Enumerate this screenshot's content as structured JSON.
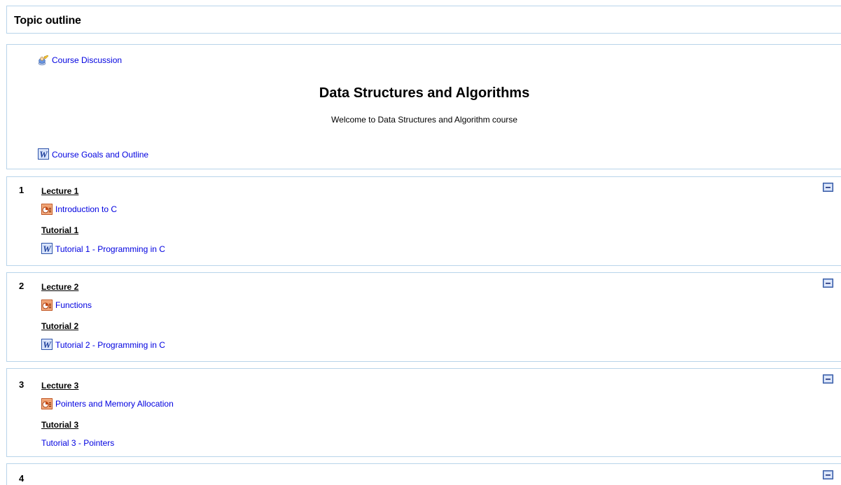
{
  "header": {
    "title": "Topic outline"
  },
  "intro": {
    "forum_link": "Course Discussion",
    "course_title": "Data Structures and Algorithms",
    "course_subtitle": "Welcome to Data Structures and Algorithm course",
    "goals_link": "Course Goals and Outline"
  },
  "sections": [
    {
      "number": "1",
      "lecture_heading": "Lecture 1",
      "lecture_link": "Introduction to C",
      "tutorial_heading": "Tutorial 1",
      "tutorial_link": "Tutorial 1 - Programming in C"
    },
    {
      "number": "2",
      "lecture_heading": "Lecture 2",
      "lecture_link": "Functions",
      "tutorial_heading": "Tutorial 2",
      "tutorial_link": "Tutorial 2 - Programming in C"
    },
    {
      "number": "3",
      "lecture_heading": "Lecture 3",
      "lecture_link": "Pointers and Memory Allocation",
      "tutorial_heading": "Tutorial 3",
      "tutorial_link": "Tutorial 3 - Pointers"
    },
    {
      "number": "4"
    }
  ],
  "icons": {
    "forum": "forum-icon",
    "word": "word-document-icon",
    "powerpoint": "powerpoint-icon",
    "collapse": "collapse-section-icon"
  },
  "colors": {
    "link": "#0000e0",
    "border": "#b8d4ea",
    "collapse_button": "#2a4f9e"
  }
}
